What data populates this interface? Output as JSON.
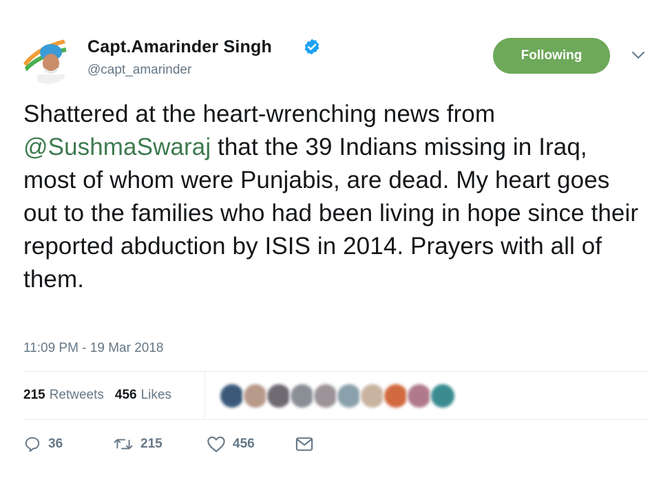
{
  "user": {
    "name": "Capt.Amarinder Singh",
    "handle": "@capt_amarinder",
    "verified": true,
    "avatar_icon": "profile-photo-icon"
  },
  "follow_button": {
    "label": "Following",
    "color": "#6ea85a"
  },
  "tweet": {
    "text_before": "Shattered at the heart-wrenching news from ",
    "mention": "@SushmaSwaraj",
    "text_after": " that the 39 Indians missing in Iraq, most of whom were Punjabis, are dead. My heart goes out to the families who had been living in hope since their reported abduction by ISIS in 2014. Prayers with all of them.",
    "timestamp": "11:09 PM - 19 Mar 2018"
  },
  "stats": {
    "retweets_count": "215",
    "retweets_label": "Retweets",
    "likes_count": "456",
    "likes_label": "Likes"
  },
  "actions": {
    "reply_count": "36",
    "retweet_count": "215",
    "like_count": "456"
  },
  "colors": {
    "mention": "#3d7a4e",
    "secondary_text": "#657786",
    "verified_badge": "#1da1f2"
  }
}
